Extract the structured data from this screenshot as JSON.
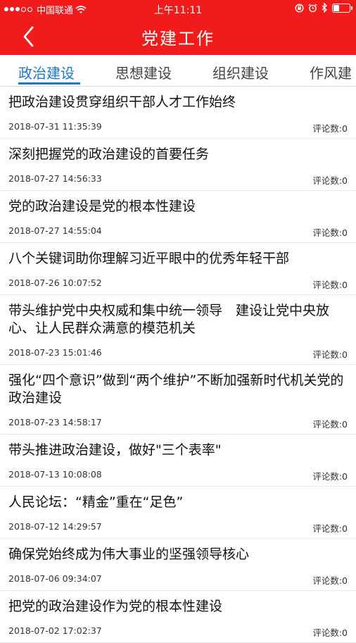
{
  "status_bar": {
    "carrier": "中国联通",
    "time": "上午11:11",
    "battery_level": 0.35
  },
  "nav": {
    "title": "党建工作"
  },
  "tabs": [
    {
      "label": "政治建设",
      "active": true
    },
    {
      "label": "思想建设",
      "active": false
    },
    {
      "label": "组织建设",
      "active": false
    },
    {
      "label": "作风建",
      "active": false
    }
  ],
  "news": [
    {
      "title": "把政治建设贯穿组织干部人才工作始终",
      "date": "2018-07-31 11:35:39",
      "comments": "评论数:0"
    },
    {
      "title": "深刻把握党的政治建设的首要任务",
      "date": "2018-07-27 14:56:33",
      "comments": "评论数:0"
    },
    {
      "title": "党的政治建设是党的根本性建设",
      "date": "2018-07-27 14:55:04",
      "comments": "评论数:0"
    },
    {
      "title": "八个关键词助你理解习近平眼中的优秀年轻干部",
      "date": "2018-07-26 10:07:52",
      "comments": "评论数:0"
    },
    {
      "title": "带头维护党中央权威和集中统一领导　建设让党中央放心、让人民群众满意的模范机关",
      "date": "2018-07-23 15:01:46",
      "comments": "评论数:0"
    },
    {
      "title": "强化“四个意识”做到“两个维护”不断加强新时代机关党的政治建设",
      "date": "2018-07-23 14:58:17",
      "comments": "评论数:0"
    },
    {
      "title": "带头推进政治建设，做好\"三个表率\"",
      "date": "2018-07-13 10:08:08",
      "comments": "评论数:0"
    },
    {
      "title": "人民论坛：“精金”重在“足色”",
      "date": "2018-07-12 14:29:57",
      "comments": "评论数:0"
    },
    {
      "title": "确保党始终成为伟大事业的坚强领导核心",
      "date": "2018-07-06 09:34:07",
      "comments": "评论数:0"
    },
    {
      "title": "把党的政治建设作为党的根本性建设",
      "date": "2018-07-02 17:02:37",
      "comments": "评论数:0"
    }
  ]
}
